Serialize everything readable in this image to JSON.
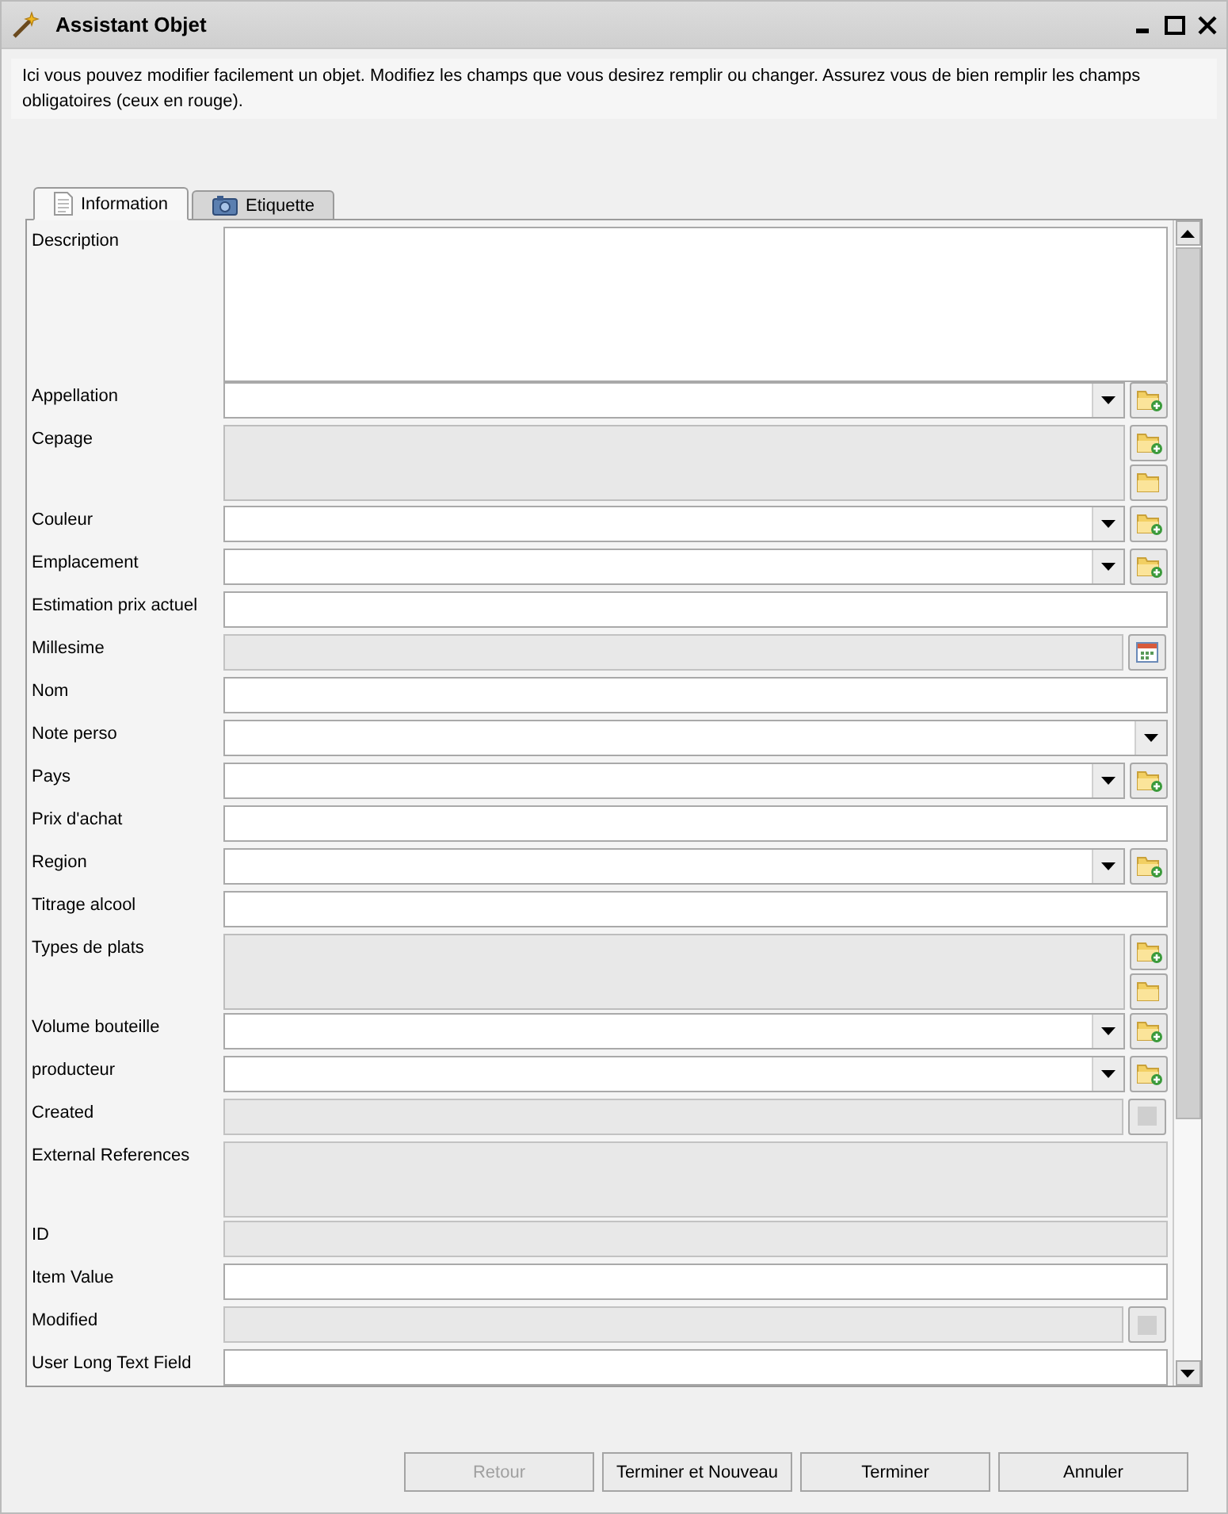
{
  "window": {
    "title": "Assistant Objet"
  },
  "intro": "Ici vous pouvez modifier facilement un objet. Modifiez les champs que vous desirez remplir ou changer. Assurez vous de bien remplir les champs obligatoires (ceux en rouge).",
  "tabs": [
    {
      "label": "Information",
      "kind": "document",
      "selected": true
    },
    {
      "label": "Etiquette",
      "kind": "camera",
      "selected": false
    }
  ],
  "fields": [
    {
      "label": "Description",
      "kind": "textarea",
      "disabled": false
    },
    {
      "label": "Appellation",
      "kind": "combo",
      "add": true
    },
    {
      "label": "Cepage",
      "kind": "list",
      "disabled": true
    },
    {
      "label": "Couleur",
      "kind": "combo",
      "add": true
    },
    {
      "label": "Emplacement",
      "kind": "combo",
      "add": true
    },
    {
      "label": "Estimation prix actuel",
      "kind": "text",
      "disabled": false
    },
    {
      "label": "Millesime",
      "kind": "date",
      "disabled": true
    },
    {
      "label": "Nom",
      "kind": "text",
      "disabled": false
    },
    {
      "label": "Note perso",
      "kind": "combo",
      "add": false
    },
    {
      "label": "Pays",
      "kind": "combo",
      "add": true
    },
    {
      "label": "Prix d'achat",
      "kind": "text",
      "disabled": false
    },
    {
      "label": "Region",
      "kind": "combo",
      "add": true
    },
    {
      "label": "Titrage alcool",
      "kind": "text",
      "disabled": false
    },
    {
      "label": "Types de plats",
      "kind": "list",
      "disabled": true
    },
    {
      "label": "Volume bouteille",
      "kind": "combo",
      "add": true
    },
    {
      "label": "producteur",
      "kind": "combo",
      "add": true
    },
    {
      "label": "Created",
      "kind": "stamp",
      "disabled": true
    },
    {
      "label": "External References",
      "kind": "textarea",
      "disabled": true
    },
    {
      "label": "ID",
      "kind": "text",
      "disabled": true
    },
    {
      "label": "Item Value",
      "kind": "text",
      "disabled": false
    },
    {
      "label": "Modified",
      "kind": "stamp",
      "disabled": true
    },
    {
      "label": "User Long Text Field",
      "kind": "text",
      "disabled": false
    }
  ],
  "buttons": [
    {
      "label": "Retour",
      "disabled": true
    },
    {
      "label": "Terminer et Nouveau",
      "disabled": false
    },
    {
      "label": "Terminer",
      "disabled": false
    },
    {
      "label": "Annuler",
      "disabled": false
    }
  ]
}
